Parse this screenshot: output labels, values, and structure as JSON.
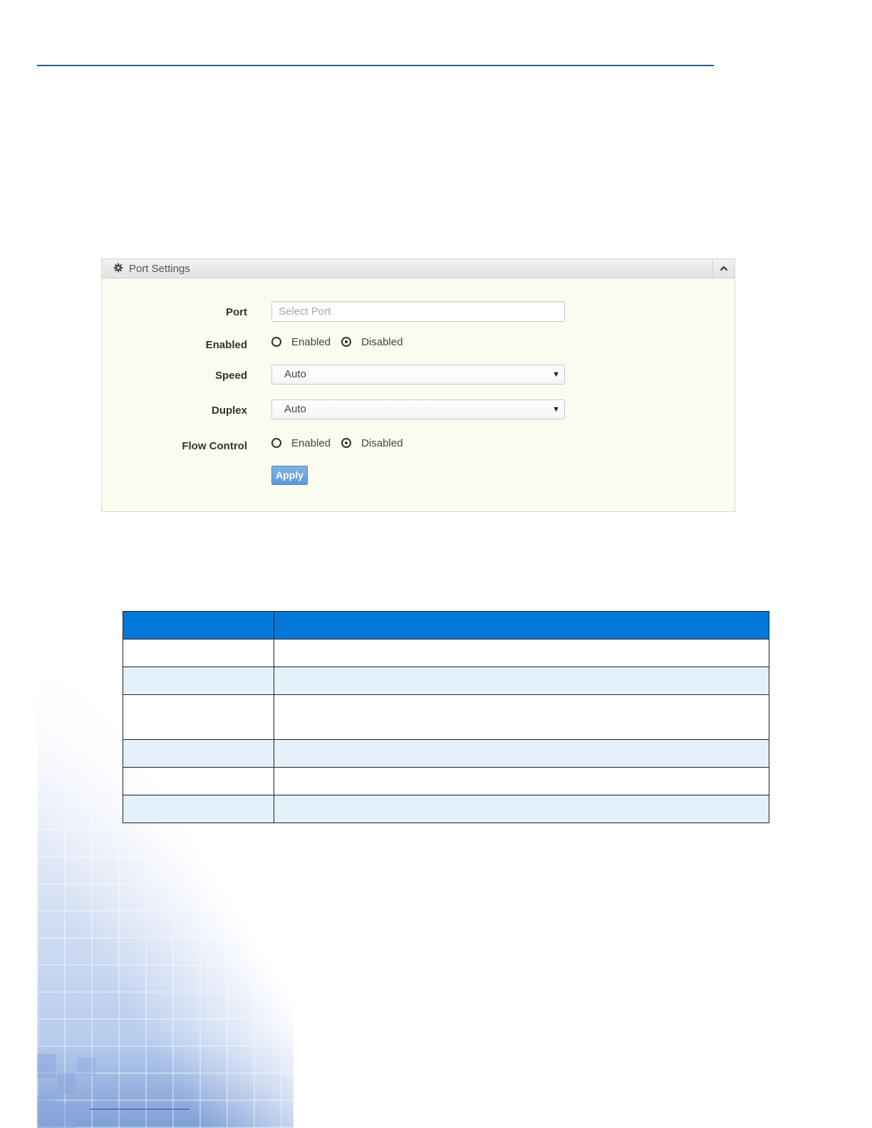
{
  "panel": {
    "title": "Port Settings",
    "icons": {
      "header": "gear-icon",
      "collapse": "chevron-up-icon"
    },
    "port": {
      "label": "Port",
      "placeholder": "Select Port",
      "value": ""
    },
    "enabled": {
      "label": "Enabled",
      "option_enabled": "Enabled",
      "option_disabled": "Disabled",
      "selected": "Disabled"
    },
    "speed": {
      "label": "Speed",
      "value": "Auto"
    },
    "duplex": {
      "label": "Duplex",
      "value": "Auto"
    },
    "flow_control": {
      "label": "Flow Control",
      "option_enabled": "Enabled",
      "option_disabled": "Disabled",
      "selected": "Disabled"
    },
    "apply_label": "Apply"
  },
  "table": {
    "header_color": "#0278d7",
    "alt_row_color": "#e4f0fb",
    "rows": 6
  },
  "colors": {
    "rule": "#1f5f8b",
    "panel_bg": "#fcfbef",
    "apply_button": "#6fa8de"
  }
}
